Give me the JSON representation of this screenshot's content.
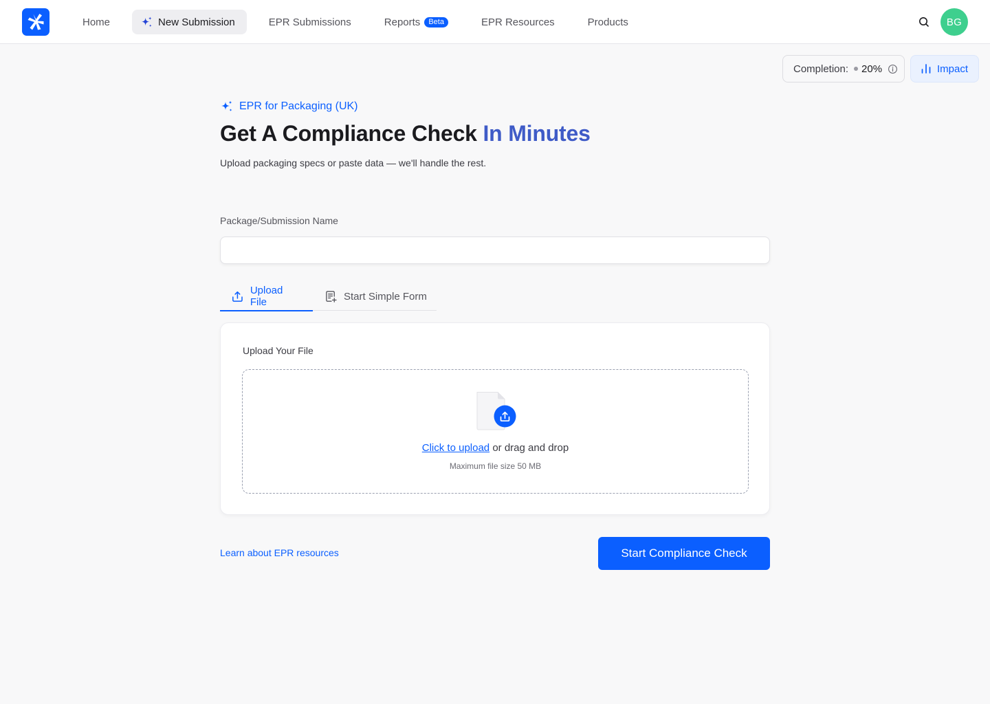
{
  "nav": {
    "items": [
      {
        "label": "Home"
      },
      {
        "label": "New Submission"
      },
      {
        "label": "EPR Submissions"
      },
      {
        "label": "Reports",
        "badge": "Beta"
      },
      {
        "label": "EPR Resources"
      },
      {
        "label": "Products"
      }
    ],
    "avatar_initials": "BG"
  },
  "completion": {
    "label": "Completion:",
    "value": "20%"
  },
  "impact_label": "Impact",
  "header": {
    "eyebrow": "EPR for Packaging (UK)",
    "title_main": "Get A Compliance Check ",
    "title_accent": "In Minutes",
    "subtitle": "Upload packaging specs or paste data — we'll handle the rest."
  },
  "form": {
    "name_label": "Package/Submission Name",
    "name_value": "",
    "name_placeholder": ""
  },
  "tabs": [
    {
      "label": "Upload File",
      "active": true
    },
    {
      "label": "Start Simple Form",
      "active": false
    }
  ],
  "upload": {
    "card_label": "Upload Your File",
    "link_text": "Click to upload",
    "rest_text": " or drag and drop",
    "note": "Maximum file size 50 MB"
  },
  "footer": {
    "learn_link": "Learn about EPR resources",
    "primary_button": "Start Compliance Check"
  },
  "colors": {
    "brand": "#0b5fff",
    "title_accent": "#3f5bc7",
    "avatar": "#3ecf8e"
  }
}
